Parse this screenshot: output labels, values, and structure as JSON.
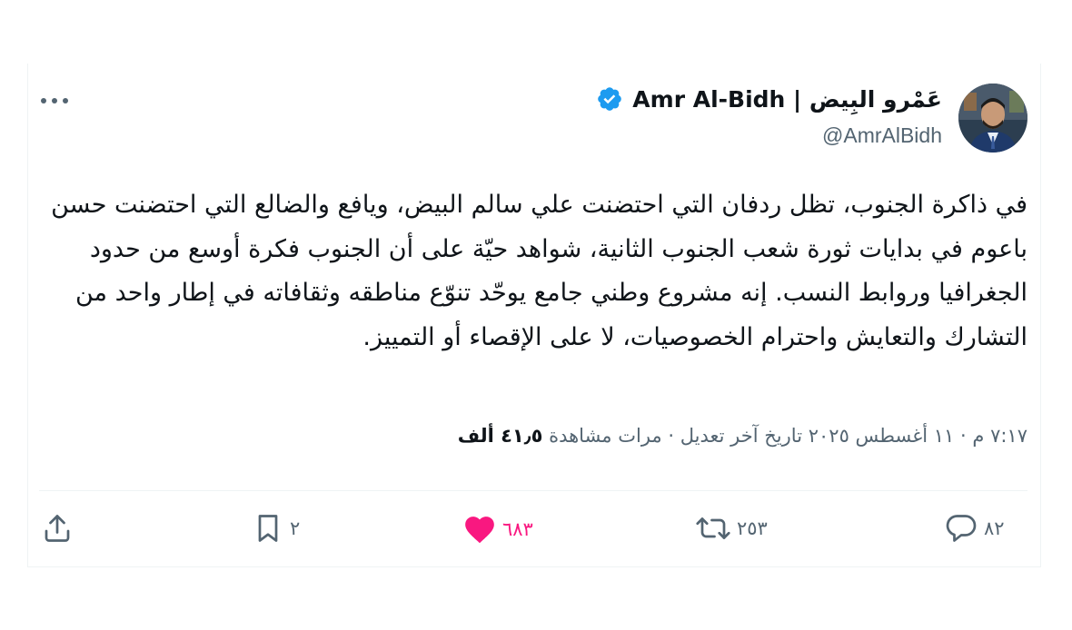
{
  "tweet": {
    "display_name": "عَمْرو البِيض | Amr Al-Bidh",
    "handle": "@AmrAlBidh",
    "text": "في ذاكرة الجنوب، تظل ردفان التي احتضنت علي سالم البيض، ويافع والضالع التي احتضنت حسن باعوم في بدايات ثورة شعب الجنوب الثانية، شواهد حيّة على أن الجنوب فكرة أوسع من حدود الجغرافيا وروابط النسب. إنه مشروع وطني جامع يوحّد تنوّع مناطقه وثقافاته في إطار واحد من التشارك والتعايش واحترام الخصوصيات، لا على الإقصاء أو التمييز.",
    "time": "٧:١٧ م",
    "date": "١١ أغسطس ٢٠٢٥",
    "edited_label": "تاريخ آخر تعديل",
    "views_count": "٤١٫٥ ألف",
    "views_label": "مرات مشاهدة",
    "separator": "·"
  },
  "actions": {
    "replies": "٨٢",
    "reposts": "٢٥٣",
    "likes": "٦٨٣",
    "bookmarks": "٢"
  },
  "icons": {
    "verified": "verified-badge-icon",
    "more": "more-icon",
    "reply": "reply-icon",
    "repost": "repost-icon",
    "like": "heart-icon",
    "bookmark": "bookmark-icon",
    "share": "share-icon"
  },
  "colors": {
    "verified_blue": "#1d9bf0",
    "like_pink": "#f91880",
    "secondary_text": "#536471",
    "primary_text": "#0f1419"
  }
}
